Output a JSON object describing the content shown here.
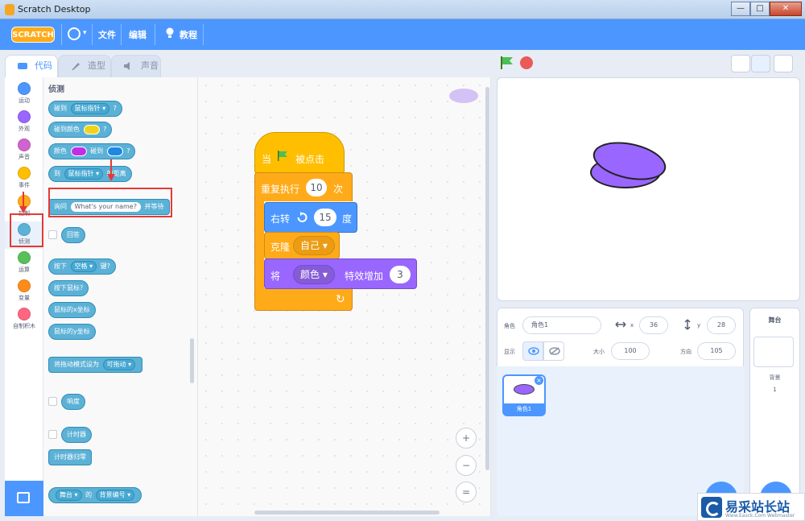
{
  "window": {
    "title": "Scratch Desktop",
    "minimize": "—",
    "maximize": "□",
    "close": "✕"
  },
  "menubar": {
    "logo": "SCRATCH",
    "file": "文件",
    "edit": "编辑",
    "tutorials": "教程",
    "language_icon": "globe-icon",
    "language_caret": "▾"
  },
  "tabs": [
    {
      "label": "代码",
      "icon": "code-icon"
    },
    {
      "label": "造型",
      "icon": "brush-icon"
    },
    {
      "label": "声音",
      "icon": "speaker-icon"
    }
  ],
  "categories": [
    {
      "label": "运动",
      "color": "#4c97ff"
    },
    {
      "label": "外观",
      "color": "#9966ff"
    },
    {
      "label": "声音",
      "color": "#cf63cf"
    },
    {
      "label": "事件",
      "color": "#ffbf00"
    },
    {
      "label": "控制",
      "color": "#ffab19"
    },
    {
      "label": "侦测",
      "color": "#5cb1d6"
    },
    {
      "label": "运算",
      "color": "#59c059"
    },
    {
      "label": "变量",
      "color": "#ff8c1a"
    },
    {
      "label": "自制积木",
      "color": "#ff6680"
    }
  ],
  "palette": {
    "heading": "侦测",
    "touching": {
      "label": "碰到",
      "dropdown": "鼠标指针 ▾",
      "end": "?"
    },
    "touching_color": {
      "label": "碰到颜色",
      "end": "?",
      "color": "#f2d31b"
    },
    "color_touching": {
      "label1": "颜色",
      "label2": "碰到",
      "end": "?",
      "color1": "#c22ee8",
      "color2": "#1e88e5"
    },
    "distance": {
      "label": "到",
      "dropdown": "鼠标指针 ▾",
      "end": "的距离"
    },
    "ask": {
      "label1": "询问",
      "input": "What's your name?",
      "label2": "并等待"
    },
    "answer": "回答",
    "key_pressed": {
      "label1": "按下",
      "dropdown": "空格 ▾",
      "label2": "键?"
    },
    "mouse_down": "按下鼠标?",
    "mouse_x": "鼠标的x坐标",
    "mouse_y": "鼠标的y坐标",
    "drag_mode": {
      "label": "将拖动模式设为",
      "dropdown": "可拖动 ▾"
    },
    "loudness": "响度",
    "timer": "计时器",
    "reset_timer": "计时器归零",
    "of": {
      "dropdown1": "舞台 ▾",
      "label": "的",
      "dropdown2": "背景编号 ▾"
    }
  },
  "script": {
    "when_flag": {
      "label1": "当",
      "label2": "被点击"
    },
    "repeat": {
      "label1": "重复执行",
      "count": "10",
      "label2": "次"
    },
    "turn": {
      "label1": "右转",
      "degrees": "15",
      "label2": "度"
    },
    "clone": {
      "label": "克隆",
      "target": "自己 ▾"
    },
    "effect": {
      "label1": "将",
      "effect": "颜色 ▾",
      "label2": "特效增加",
      "value": "3"
    },
    "loop_arrow": "↻"
  },
  "zoom": {
    "in": "+",
    "out": "−",
    "reset": "="
  },
  "sprite_info": {
    "sprite_label": "角色",
    "sprite_name": "角色1",
    "x_label": "x",
    "x_value": "36",
    "y_label": "y",
    "y_value": "28",
    "show_label": "显示",
    "size_label": "大小",
    "size_value": "100",
    "direction_label": "方向",
    "direction_value": "105"
  },
  "sprites": [
    {
      "name": "角色1",
      "delete": "×"
    }
  ],
  "backdrop": {
    "heading": "舞台",
    "label": "背景",
    "count": "1"
  },
  "watermark": {
    "text": "易采站长站",
    "sub": "Www.Easck.Com Webmaster"
  }
}
